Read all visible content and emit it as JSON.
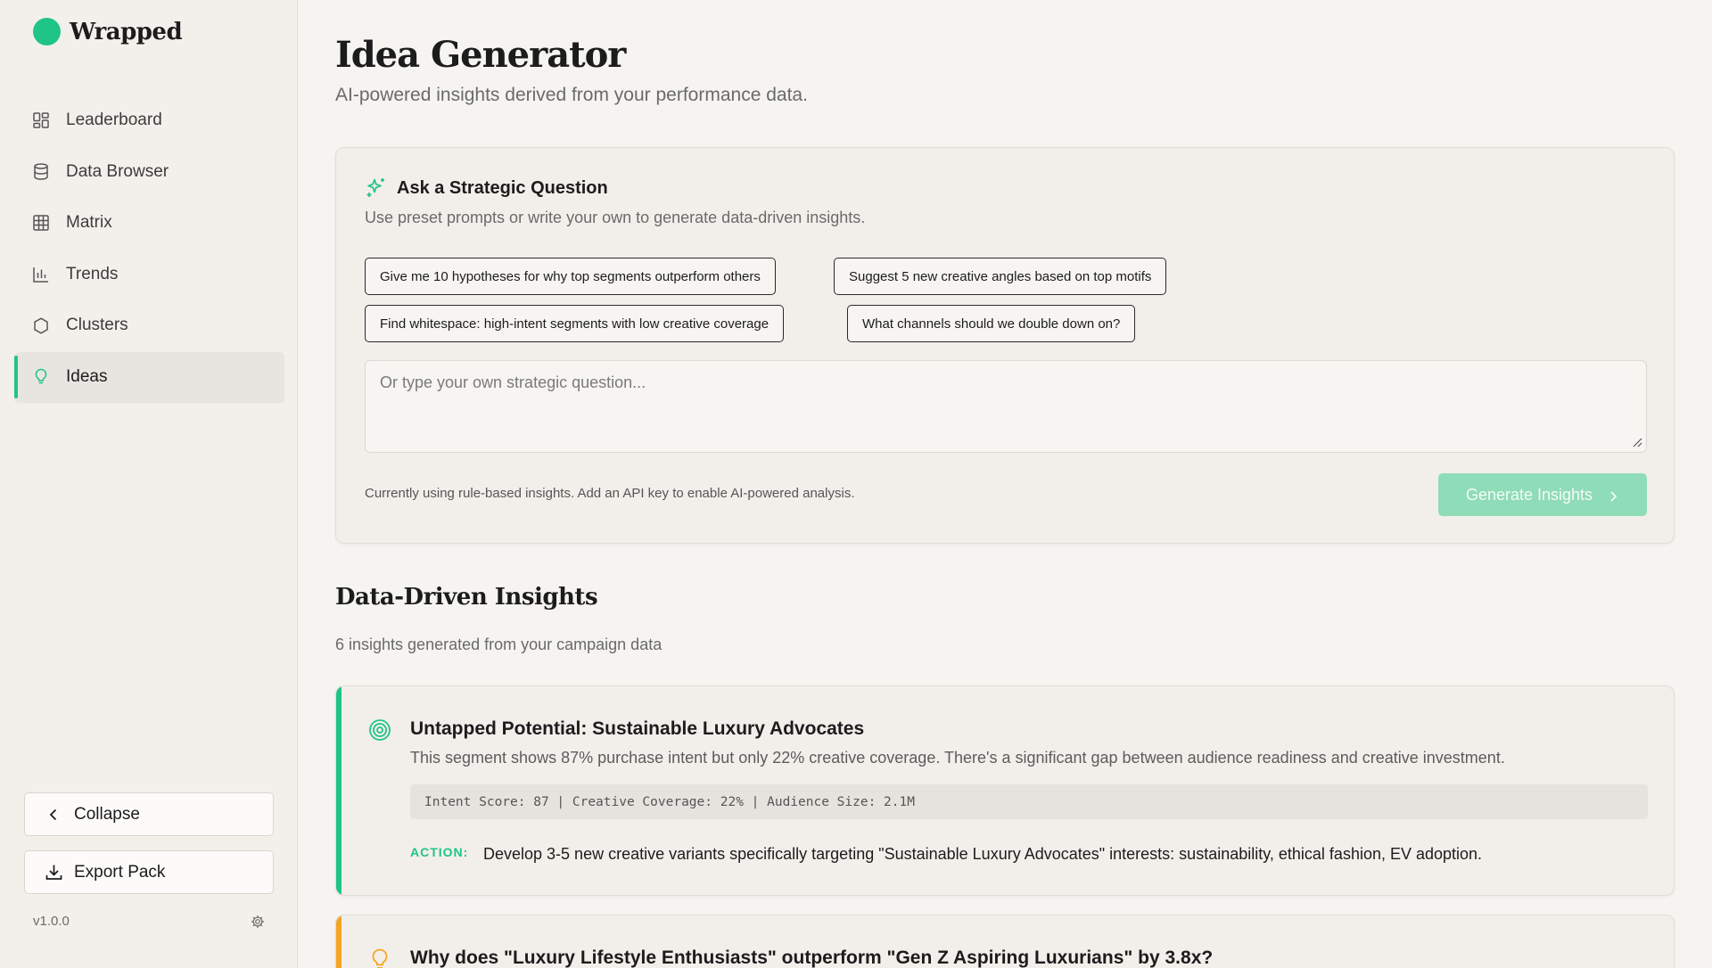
{
  "app": {
    "name": "Wrapped",
    "version": "v1.0.0"
  },
  "colors": {
    "accent": "#1fc487",
    "warning": "#f5a524",
    "background": "#f6f4f0"
  },
  "sidebar": {
    "items": [
      {
        "label": "Leaderboard",
        "icon": "dashboard-icon",
        "active": false
      },
      {
        "label": "Data Browser",
        "icon": "database-icon",
        "active": false
      },
      {
        "label": "Matrix",
        "icon": "grid-icon",
        "active": false
      },
      {
        "label": "Trends",
        "icon": "bar-chart-icon",
        "active": false
      },
      {
        "label": "Clusters",
        "icon": "hexagon-icon",
        "active": false
      },
      {
        "label": "Ideas",
        "icon": "lightbulb-icon",
        "active": true
      }
    ],
    "collapse_label": "Collapse",
    "export_label": "Export Pack"
  },
  "main": {
    "title": "Idea Generator",
    "subtitle": "AI-powered insights derived from your performance data.",
    "ask": {
      "title": "Ask a Strategic Question",
      "subtitle": "Use preset prompts or write your own to generate data-driven insights.",
      "presets": [
        "Give me 10 hypotheses for why top segments outperform others",
        "Suggest 5 new creative angles based on top motifs",
        "Find whitespace: high-intent segments with low creative coverage",
        "What channels should we double down on?"
      ],
      "placeholder": "Or type your own strategic question...",
      "value": "",
      "note": "Currently using rule-based insights. Add an API key to enable AI-powered analysis.",
      "generate_label": "Generate Insights"
    },
    "insights_title": "Data-Driven Insights",
    "insights_subtitle": "6 insights generated from your campaign data",
    "insights": [
      {
        "icon": "target-icon",
        "title": "Untapped Potential: Sustainable Luxury Advocates",
        "description": "This segment shows 87% purchase intent but only 22% creative coverage. There's a significant gap between audience readiness and creative investment.",
        "metrics": "Intent Score: 87 | Creative Coverage: 22% | Audience Size: 2.1M",
        "action_label": "ACTION:",
        "action": "Develop 3-5 new creative variants specifically targeting \"Sustainable Luxury Advocates\" interests: sustainability, ethical fashion, EV adoption."
      },
      {
        "icon": "lightbulb-icon",
        "title": "Why does \"Luxury Lifestyle Enthusiasts\" outperform \"Gen Z Aspiring Luxurians\" by 3.8x?"
      }
    ]
  }
}
